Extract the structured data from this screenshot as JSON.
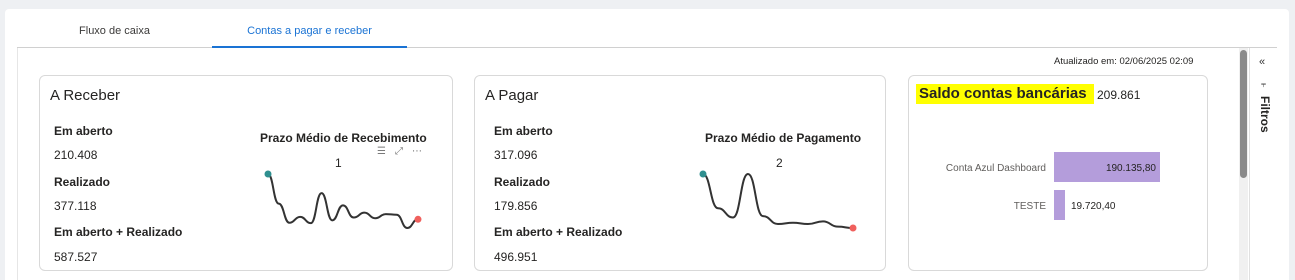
{
  "tabs": [
    {
      "label": "Fluxo de caixa",
      "active": false
    },
    {
      "label": "Contas a pagar e receber",
      "active": true
    }
  ],
  "updated_text": "Atualizado em: 02/06/2025 02:09",
  "receber": {
    "title": "A Receber",
    "aberto_label": "Em aberto",
    "aberto_value": "210.408",
    "realizado_label": "Realizado",
    "realizado_value": "377.118",
    "total_label": "Em aberto + Realizado",
    "total_value": "587.527",
    "chart_title": "Prazo Médio de Recebimento",
    "chart_value": "1",
    "tool_icons": [
      "filter-icon",
      "focus-mode-icon",
      "more-options-icon"
    ]
  },
  "pagar": {
    "title": "A Pagar",
    "aberto_label": "Em aberto",
    "aberto_value": "317.096",
    "realizado_label": "Realizado",
    "realizado_value": "179.856",
    "total_label": "Em aberto + Realizado",
    "total_value": "496.951",
    "chart_title": "Prazo Médio de Pagamento",
    "chart_value": "2"
  },
  "saldo": {
    "title": "Saldo contas bancárias",
    "total": "209.861",
    "highlight_color": "#ffff00"
  },
  "chart_data": [
    {
      "type": "bar",
      "orientation": "horizontal",
      "categories": [
        "Conta Azul Dashboard",
        "TESTE"
      ],
      "values": [
        190135.8,
        19720.4
      ],
      "data_labels": [
        "190.135,80",
        "19.720,40"
      ],
      "xlim": [
        0,
        190135.8
      ],
      "color": "#b49ddb"
    }
  ],
  "sparks": {
    "receber": {
      "values": [
        1.45,
        0.6,
        0.05,
        0.22,
        0.04,
        0.9,
        0.12,
        0.55,
        0.2,
        0.34,
        0.18,
        0.3,
        0.28,
        -0.1,
        0.15
      ],
      "start_color": "#2f8f8f",
      "end_color": "#f0605d",
      "line_color": "#333333"
    },
    "pagar": {
      "values": [
        2.9,
        1.6,
        1.25,
        2.9,
        1.3,
        1.0,
        1.05,
        1.0,
        1.1,
        0.9,
        0.85
      ],
      "start_color": "#2f8f8f",
      "end_color": "#f0605d",
      "line_color": "#333333"
    }
  },
  "filters": {
    "label": "Filtros",
    "collapse_icon": "chevron-double-left-icon",
    "filter_icon": "filter-icon"
  }
}
